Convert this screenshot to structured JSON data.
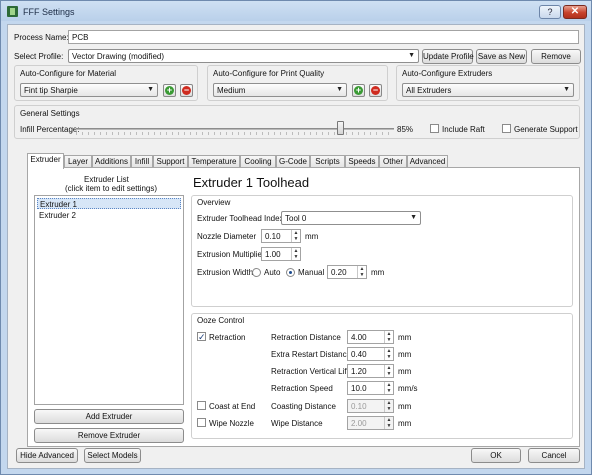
{
  "window": {
    "title": "FFF Settings",
    "help": "?",
    "close": "✕"
  },
  "process": {
    "label": "Process Name:",
    "value": "PCB"
  },
  "profile": {
    "label": "Select Profile:",
    "value": "Vector Drawing (modified)",
    "update": "Update Profile",
    "save_as_new": "Save as New",
    "remove": "Remove"
  },
  "autoconfig": {
    "material": {
      "label": "Auto-Configure for Material",
      "value": "Fint tip Sharpie"
    },
    "quality": {
      "label": "Auto-Configure for Print Quality",
      "value": "Medium"
    },
    "extruders": {
      "label": "Auto-Configure Extruders",
      "value": "All Extruders"
    }
  },
  "general": {
    "label": "General Settings",
    "infill_label": "Infill Percentage:",
    "infill_value": "85%",
    "infill_fraction": 0.85,
    "include_raft": "Include Raft",
    "generate_support": "Generate Support"
  },
  "tabs": [
    "Extruder",
    "Layer",
    "Additions",
    "Infill",
    "Support",
    "Temperature",
    "Cooling",
    "G-Code",
    "Scripts",
    "Speeds",
    "Other",
    "Advanced"
  ],
  "extruder_list": {
    "title": "Extruder List",
    "subtitle": "(click item to edit settings)",
    "items": [
      "Extruder 1",
      "Extruder 2"
    ],
    "add": "Add Extruder",
    "remove": "Remove Extruder"
  },
  "toolhead": {
    "heading": "Extruder 1 Toolhead",
    "overview": {
      "label": "Overview",
      "index_label": "Extruder Toolhead Index",
      "index_value": "Tool 0",
      "nozzle_label": "Nozzle Diameter",
      "nozzle_value": "0.10",
      "nozzle_unit": "mm",
      "multiplier_label": "Extrusion Multiplier",
      "multiplier_value": "1.00",
      "width_label": "Extrusion Width",
      "auto": "Auto",
      "manual": "Manual",
      "width_value": "0.20",
      "width_unit": "mm"
    },
    "ooze": {
      "label": "Ooze Control",
      "retraction": "Retraction",
      "coast_at_end": "Coast at End",
      "wipe_nozzle": "Wipe Nozzle",
      "rows": [
        {
          "label": "Retraction Distance",
          "value": "4.00",
          "unit": "mm",
          "disabled": false
        },
        {
          "label": "Extra Restart Distance",
          "value": "0.40",
          "unit": "mm",
          "disabled": false
        },
        {
          "label": "Retraction Vertical Lift",
          "value": "1.20",
          "unit": "mm",
          "disabled": false
        },
        {
          "label": "Retraction Speed",
          "value": "10.0",
          "unit": "mm/s",
          "disabled": false
        },
        {
          "label": "Coasting Distance",
          "value": "0.10",
          "unit": "mm",
          "disabled": true
        },
        {
          "label": "Wipe Distance",
          "value": "2.00",
          "unit": "mm",
          "disabled": true
        }
      ]
    }
  },
  "footer": {
    "hide_advanced": "Hide Advanced",
    "select_models": "Select Models",
    "ok": "OK",
    "cancel": "Cancel"
  }
}
